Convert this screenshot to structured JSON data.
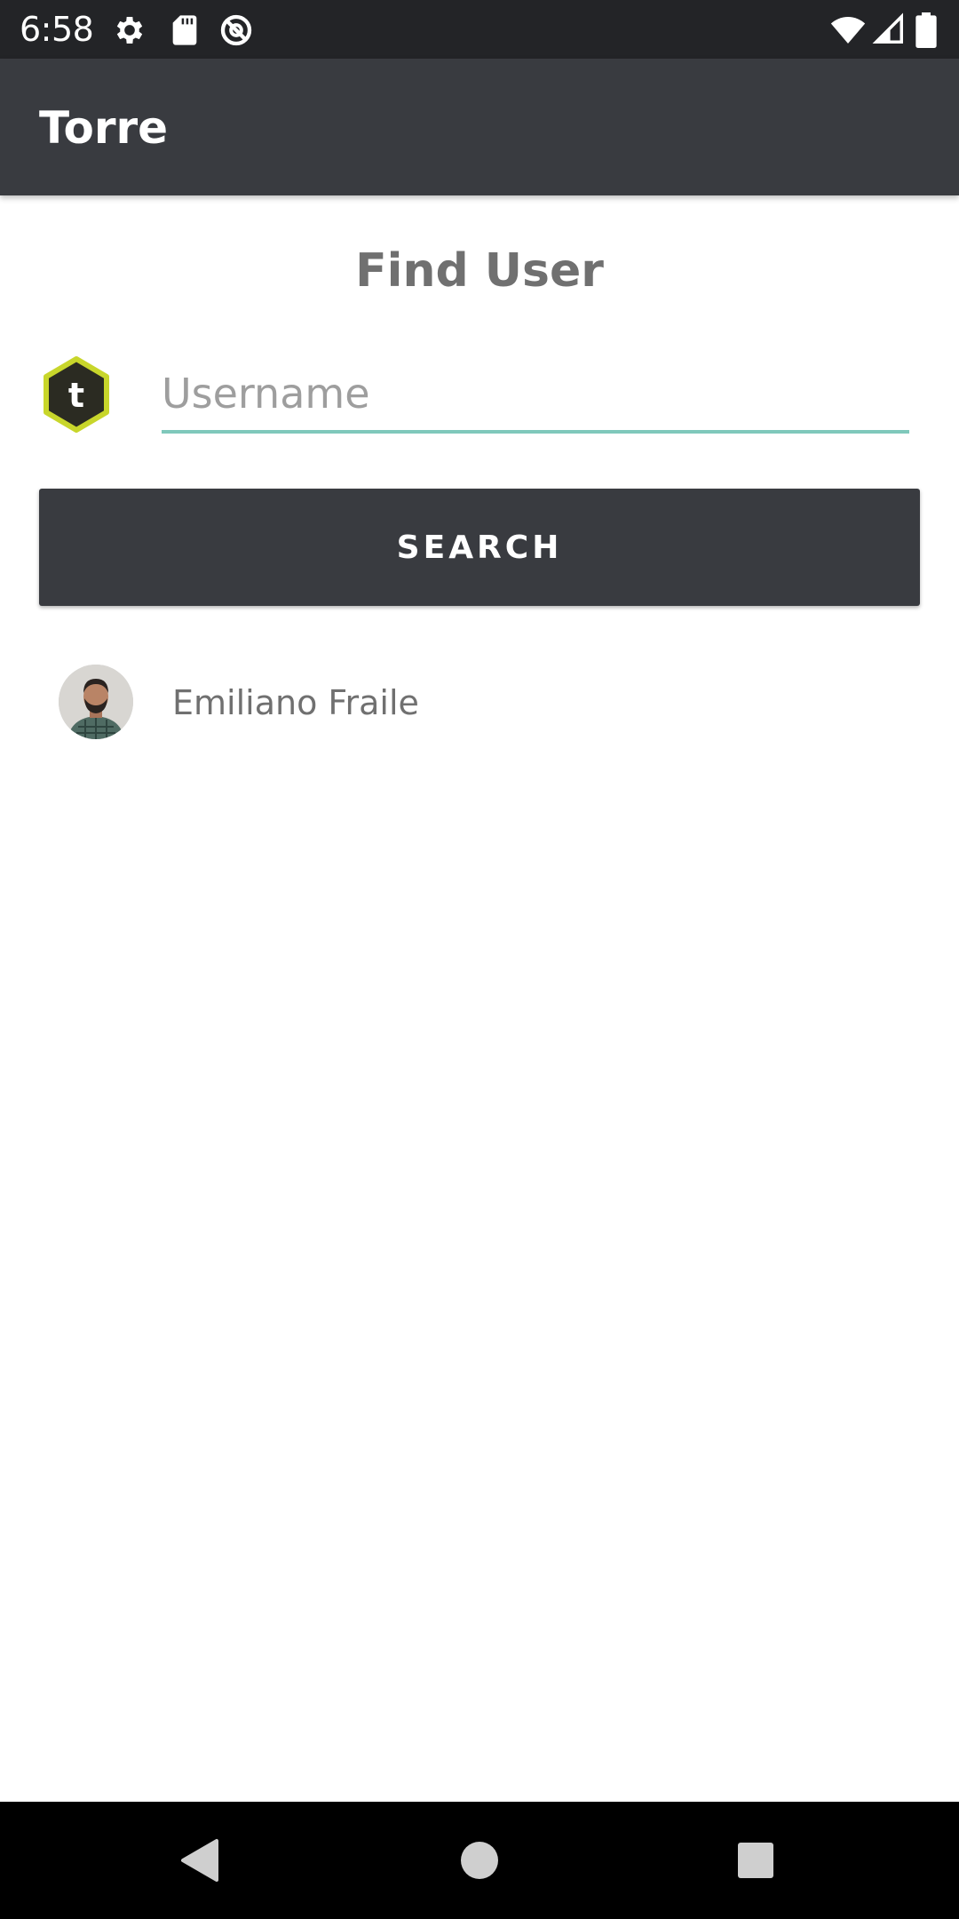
{
  "status_bar": {
    "time": "6:58",
    "left_icons": [
      "settings-icon",
      "sd-card-icon",
      "data-saver-icon"
    ],
    "right_icons": [
      "wifi-icon",
      "signal-icon",
      "battery-icon"
    ]
  },
  "app_bar": {
    "title": "Torre"
  },
  "main": {
    "heading": "Find User",
    "logo_letter": "t",
    "username_input": {
      "value": "",
      "placeholder": "Username"
    },
    "search_button_label": "SEARCH",
    "results": [
      {
        "name": "Emiliano Fraile",
        "avatar": "user-photo"
      }
    ]
  },
  "nav_bar": {
    "buttons": [
      "back-icon",
      "home-icon",
      "recents-icon"
    ]
  },
  "colors": {
    "app_bar": "#393b40",
    "status_bar": "#232427",
    "accent_underline": "#7fc8bb",
    "logo_border": "#c8d62b",
    "logo_fill": "#2b2b22",
    "text_gray": "#707070"
  }
}
